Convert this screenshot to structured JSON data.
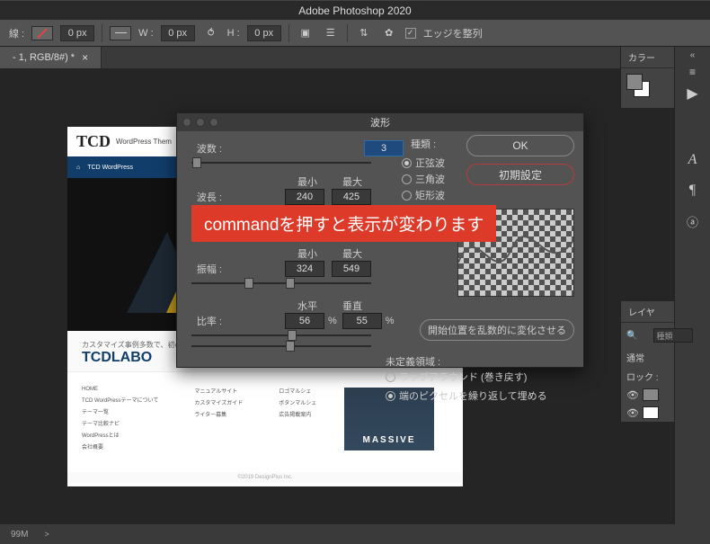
{
  "app_title": "Adobe Photoshop 2020",
  "options_bar": {
    "stroke_label": "線 :",
    "stroke_value": "0 px",
    "dash_icon": "dash",
    "width_label": "W :",
    "width_value": "0 px",
    "link_icon": "link",
    "height_label": "H :",
    "height_value": "0 px",
    "align_checkbox": true,
    "align_label": "エッジを整列"
  },
  "doc_tab": {
    "label": "- 1, RGB/8#) *"
  },
  "status": {
    "zoom": "99M",
    "arrow": ">"
  },
  "right_tabs": {
    "color": "カラー",
    "layers": "レイヤ",
    "search_placeholder": "種類",
    "mode": "通常",
    "lock": "ロック :"
  },
  "tool_icons": [
    "triangle",
    "A",
    "pilcrow",
    "ya"
  ],
  "canvas": {
    "logo": "TCD",
    "logo_sub": "WordPress Them",
    "nav_home": "TCD WordPress",
    "section_caption": "カスタマイズ事例多数で、初心者も",
    "tcdlabo": "TCDLABO",
    "footer1": [
      "HOME",
      "TCD WordPressテーマについて",
      "テーマ一覧",
      "テーマ比較ナビ",
      "WordPressとは",
      "会社概要"
    ],
    "footer2": [
      "マニュアルサイト",
      "カスタマイズガイド",
      "ライター募集"
    ],
    "footer3": [
      "ロゴマルシェ",
      "ボタンマルシェ",
      "広告掲載案内"
    ],
    "hero_card": "MASSIVE",
    "copyright": "©2019 DesignPlus Inc."
  },
  "dialog": {
    "title": "波形",
    "generators_label": "波数 :",
    "generators_value": "3",
    "type_label": "種類 :",
    "type_options": [
      "正弦波",
      "三角波",
      "矩形波"
    ],
    "type_selected": "正弦波",
    "ok": "OK",
    "reset": "初期設定",
    "min_head": "最小",
    "max_head": "最大",
    "wavelength_label": "波長 :",
    "wavelength_min": "240",
    "wavelength_max": "425",
    "amplitude_label": "振幅 :",
    "amplitude_min": "324",
    "amplitude_max": "549",
    "horiz_head": "水平",
    "vert_head": "垂直",
    "scale_label": "比率 :",
    "scale_h": "56",
    "scale_v": "55",
    "pct": "%",
    "randomize": "開始位置を乱数的に変化させる",
    "undefined_label": "未定義領域 :",
    "undefined_options": [
      "ラップアラウンド (巻き戻す)",
      "端のピクセルを繰り返して埋める"
    ],
    "undefined_selected": "端のピクセルを繰り返して埋める"
  },
  "annotation": "commandを押すと表示が変わります"
}
